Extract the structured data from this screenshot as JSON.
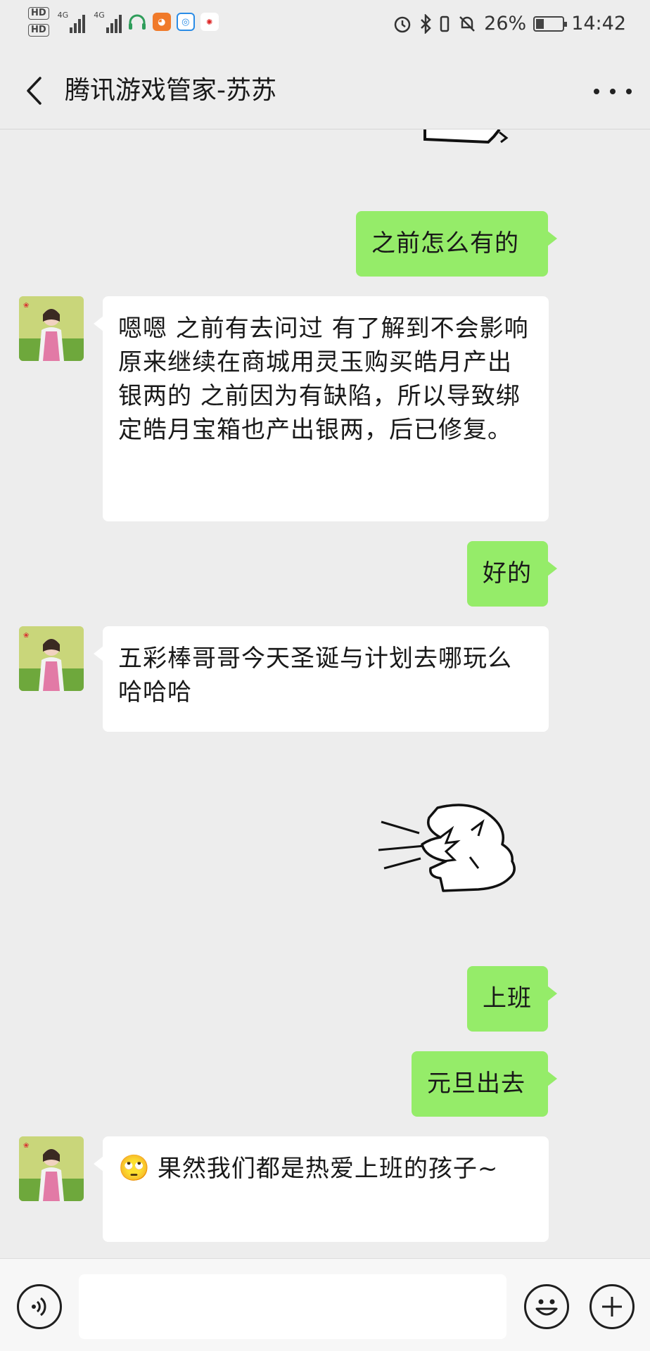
{
  "status_bar": {
    "hd1": "HD",
    "hd2": "HD",
    "net1": "4G",
    "net2": "4G",
    "battery_percent": "26%",
    "time": "14:42",
    "icons": [
      "headset-icon",
      "uc-browser-icon",
      "browser-icon",
      "sina-weibo-icon",
      "alarm-icon",
      "bluetooth-icon",
      "vibrate-icon",
      "mute-icon",
      "battery-icon"
    ]
  },
  "header": {
    "title": "腾讯游戏管家-苏苏"
  },
  "messages": [
    {
      "dir": "out",
      "text": "之前怎么有的"
    },
    {
      "dir": "in",
      "text": "嗯嗯   之前有去问过    有了解到不会影响原来继续在商城用灵玉购买皓月产出银两的    之前因为有缺陷，所以导致绑定皓月宝箱也产出银两，后已修复。"
    },
    {
      "dir": "out",
      "text": "好的"
    },
    {
      "dir": "in",
      "text": "五彩棒哥哥今天圣诞与计划去哪玩么  哈哈哈"
    },
    {
      "dir": "out",
      "text": "上班"
    },
    {
      "dir": "out",
      "text": "元旦出去"
    },
    {
      "dir": "in",
      "text": "果然我们都是热爱上班的孩子~",
      "emoji": "🙄"
    }
  ],
  "stickers": [
    "laughing-dinosaur-sticker",
    "cropped-sticker"
  ],
  "bottom_bar": {
    "input_value": "",
    "input_placeholder": ""
  },
  "colors": {
    "background": "#ededed",
    "outgoing_bubble": "#95ec69",
    "incoming_bubble": "#ffffff"
  }
}
